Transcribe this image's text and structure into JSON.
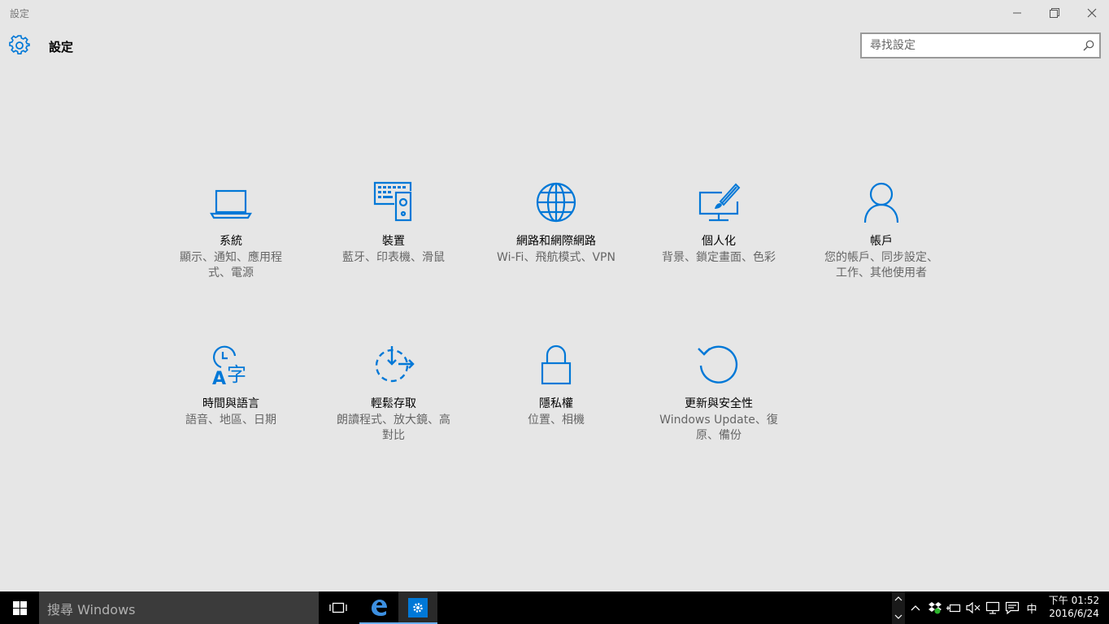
{
  "window": {
    "title": "設定"
  },
  "header": {
    "title": "設定"
  },
  "search": {
    "placeholder": "尋找設定"
  },
  "colors": {
    "accent": "#0078d7",
    "background": "#e6e6e6",
    "taskbar": "#000000"
  },
  "tiles": [
    {
      "icon": "laptop-icon",
      "title": "系統",
      "desc": [
        "顯示、通知、應用程",
        "式、電源"
      ]
    },
    {
      "icon": "devices-icon",
      "title": "裝置",
      "desc": [
        "藍牙、印表機、滑鼠"
      ]
    },
    {
      "icon": "globe-icon",
      "title": "網路和網際網路",
      "desc": [
        "Wi-Fi、飛航模式、VPN"
      ]
    },
    {
      "icon": "personalization-icon",
      "title": "個人化",
      "desc": [
        "背景、鎖定畫面、色彩"
      ]
    },
    {
      "icon": "person-icon",
      "title": "帳戶",
      "desc": [
        "您的帳戶、同步設定、",
        "工作、其他使用者"
      ]
    },
    {
      "icon": "time-language-icon",
      "title": "時間與語言",
      "desc": [
        "語音、地區、日期"
      ]
    },
    {
      "icon": "ease-of-access-icon",
      "title": "輕鬆存取",
      "desc": [
        "朗讀程式、放大鏡、高",
        "對比"
      ]
    },
    {
      "icon": "lock-icon",
      "title": "隱私權",
      "desc": [
        "位置、相機"
      ]
    },
    {
      "icon": "update-icon",
      "title": "更新與安全性",
      "desc": [
        "Windows Update、復",
        "原、備份"
      ]
    }
  ],
  "taskbar": {
    "search_placeholder": "搜尋 Windows",
    "ime": "中",
    "time": "下午 01:52",
    "date": "2016/6/24"
  }
}
